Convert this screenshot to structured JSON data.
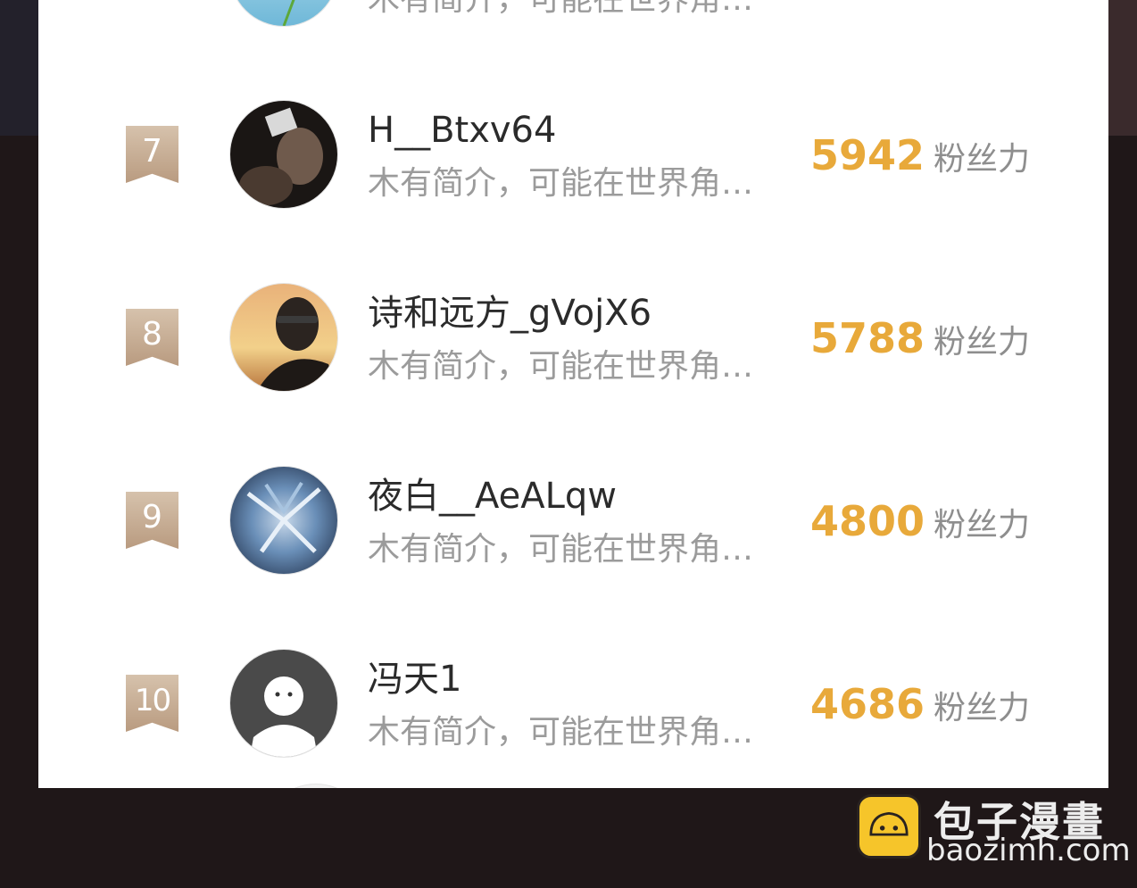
{
  "ranking": {
    "rows": [
      {
        "rank": "",
        "name": "",
        "desc": "木有简介，可能在世界角…",
        "score": "",
        "unit": ""
      },
      {
        "rank": "7",
        "name": "H__Btxv64",
        "desc": "木有简介，可能在世界角…",
        "score": "5942",
        "unit": "粉丝力"
      },
      {
        "rank": "8",
        "name": "诗和远方_gVojX6",
        "desc": "木有简介，可能在世界角…",
        "score": "5788",
        "unit": "粉丝力"
      },
      {
        "rank": "9",
        "name": "夜白__AeALqw",
        "desc": "木有简介，可能在世界角…",
        "score": "4800",
        "unit": "粉丝力"
      },
      {
        "rank": "10",
        "name": "冯天1",
        "desc": "木有简介，可能在世界角…",
        "score": "4686",
        "unit": "粉丝力"
      }
    ]
  },
  "watermark": {
    "title": "包子漫畫",
    "url": "baozimh.com"
  },
  "colors": {
    "score": "#e8a93a",
    "rank_badge": "#c8ae94",
    "page_background": "#1f1718"
  }
}
